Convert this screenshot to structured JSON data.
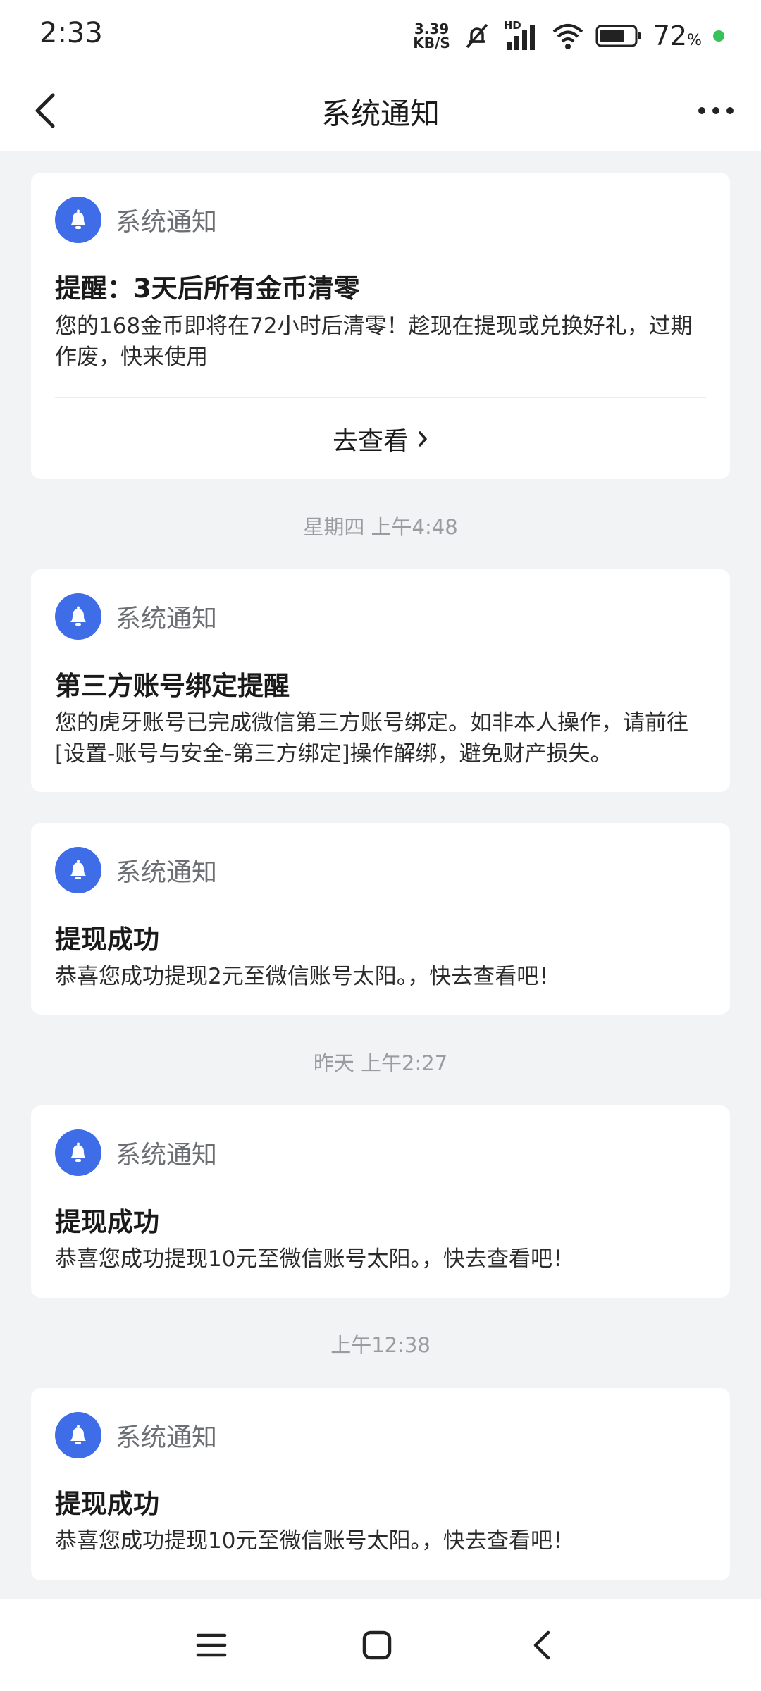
{
  "status_bar": {
    "time": "2:33",
    "net_speed_value": "3.39",
    "net_speed_unit": "KB/S",
    "hd_label": "HD",
    "battery_percent": "72",
    "percent_sign": "%"
  },
  "header": {
    "title": "系统通知"
  },
  "notifications": [
    {
      "sender": "系统通知",
      "title": "提醒：3天后所有金币清零",
      "body": "您的168金币即将在72小时后清零！趁现在提现或兑换好礼，过期作废，快来使用",
      "action_label": "去查看"
    },
    {
      "sender": "系统通知",
      "title": "第三方账号绑定提醒",
      "body": "您的虎牙账号已完成微信第三方账号绑定。如非本人操作，请前往[设置-账号与安全-第三方绑定]操作解绑，避免财产损失。"
    },
    {
      "sender": "系统通知",
      "title": "提现成功",
      "body": "恭喜您成功提现2元至微信账号太阳。，快去查看吧！"
    },
    {
      "sender": "系统通知",
      "title": "提现成功",
      "body": "恭喜您成功提现10元至微信账号太阳。，快去查看吧！"
    },
    {
      "sender": "系统通知",
      "title": "提现成功",
      "body": "恭喜您成功提现10元至微信账号太阳。，快去查看吧！"
    }
  ],
  "timestamps": [
    "星期四 上午4:48",
    "昨天 上午2:27",
    "上午12:38"
  ],
  "colors": {
    "accent": "#3f6de8",
    "background": "#f2f3f5",
    "battery_dot": "#38c35a"
  },
  "icons": {
    "back": "chevron-left-icon",
    "more": "more-horizontal-icon",
    "bell": "bell-icon",
    "menu": "menu-icon",
    "home": "square-home-icon",
    "nav_back": "nav-back-icon"
  }
}
